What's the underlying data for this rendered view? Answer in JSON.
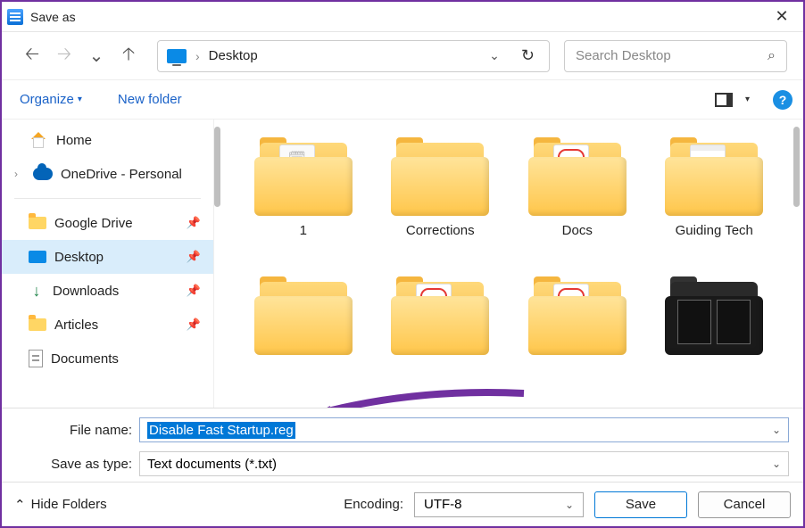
{
  "window": {
    "title": "Save as"
  },
  "nav": {
    "location": "Desktop"
  },
  "search": {
    "placeholder": "Search Desktop"
  },
  "toolbar": {
    "organize": "Organize",
    "new_folder": "New folder"
  },
  "sidebar": {
    "items": [
      {
        "label": "Home"
      },
      {
        "label": "OneDrive - Personal"
      },
      {
        "label": "Google Drive"
      },
      {
        "label": "Desktop"
      },
      {
        "label": "Downloads"
      },
      {
        "label": "Articles"
      },
      {
        "label": "Documents"
      }
    ]
  },
  "files": [
    {
      "label": "1"
    },
    {
      "label": "Corrections"
    },
    {
      "label": "Docs"
    },
    {
      "label": "Guiding Tech"
    }
  ],
  "form": {
    "filename_label": "File name:",
    "filename_value": "Disable Fast Startup.reg",
    "type_label": "Save as type:",
    "type_value": "Text documents (*.txt)"
  },
  "footer": {
    "hide_folders": "Hide Folders",
    "encoding_label": "Encoding:",
    "encoding_value": "UTF-8",
    "save": "Save",
    "cancel": "Cancel"
  }
}
